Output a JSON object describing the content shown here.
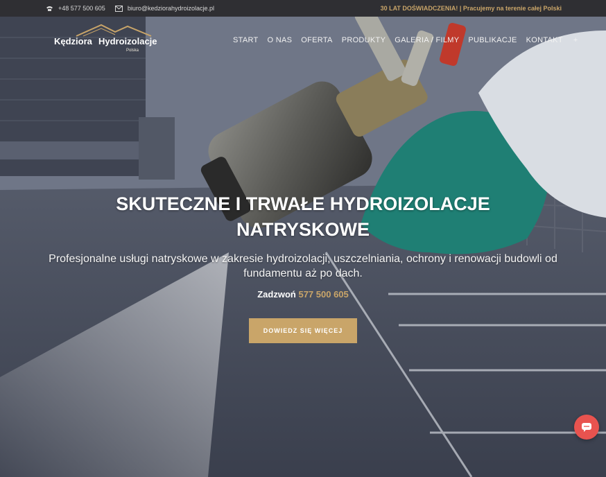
{
  "topbar": {
    "phone": "+48 577 500 605",
    "email": "biuro@kedziorahydroizolacje.pl",
    "tagline": "30 LAT DOŚWIADCZENIA! | Pracujemy na terenie całej Polski"
  },
  "logo": {
    "word1": "Kędziora",
    "word2": "Hydroizolacje",
    "sub": "Polska"
  },
  "nav": {
    "items": [
      "START",
      "O NAS",
      "OFERTA",
      "PRODUKTY",
      "GALERIA / FILMY",
      "PUBLIKACJE",
      "KONTAKT"
    ],
    "plus": "+"
  },
  "hero": {
    "headline_line1": "SKUTECZNE I TRWAŁE HYDROIZOLACJE",
    "headline_line2": "NATRYSKOWE",
    "lead": "Profesjonalne usługi natryskowe w zakresie hydroizolacji, uszczelniania, ochrony i renowacji budowli od fundamentu aż po dach.",
    "call_label": "Zadzwoń",
    "call_phone": "577 500 605",
    "cta_label": "DOWIEDZ SIĘ WIĘCEJ"
  },
  "icons": {
    "phone": "phone-icon",
    "email": "envelope-icon",
    "chat": "chat-icon"
  },
  "colors": {
    "accent": "#c9a569",
    "topbar": "#2f2f33",
    "chat": "#e8534f"
  }
}
